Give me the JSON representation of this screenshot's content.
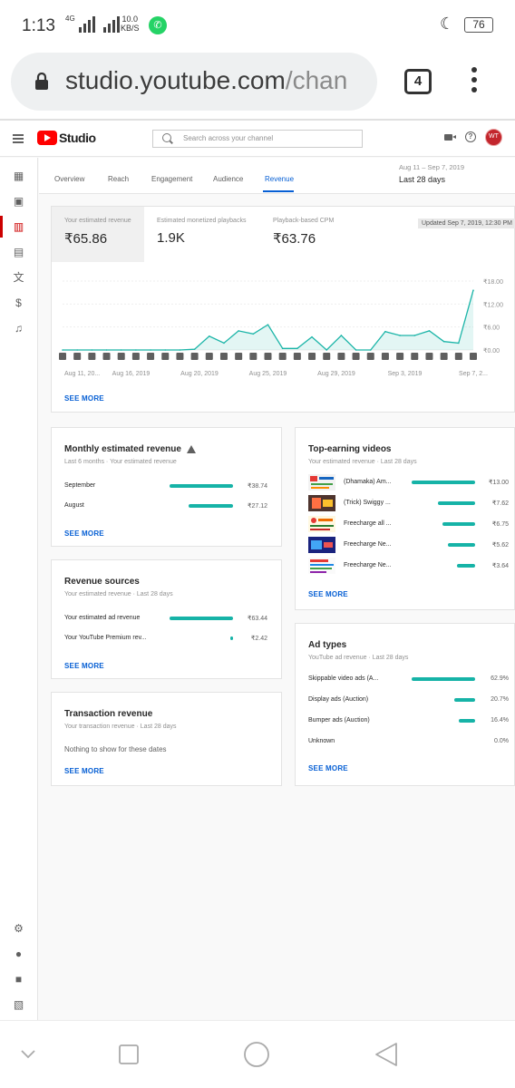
{
  "status_bar": {
    "time": "1:13",
    "network_label": "4G",
    "net_speed_value": "10.0",
    "net_speed_unit": "KB/S",
    "battery": "76"
  },
  "browser": {
    "url_host": "studio.youtube.com",
    "url_path_fragment": "/chan",
    "tab_count": "4"
  },
  "studio": {
    "app_name": "Studio",
    "search_placeholder": "Search across your channel",
    "avatar_initials": "WT",
    "tabs": [
      "Overview",
      "Reach",
      "Engagement",
      "Audience",
      "Revenue"
    ],
    "active_tab": "Revenue",
    "date_range": {
      "span": "Aug 11 – Sep 7, 2019",
      "label": "Last 28 days"
    }
  },
  "overview_card": {
    "metrics": [
      {
        "label": "Your estimated revenue",
        "value": "₹65.86"
      },
      {
        "label": "Estimated monetized playbacks",
        "value": "1.9K"
      },
      {
        "label": "Playback-based CPM",
        "value": "₹63.76"
      }
    ],
    "updated": "Updated Sep 7, 2019, 12:30 PM",
    "see_more": "SEE MORE"
  },
  "chart_data": {
    "type": "area",
    "x_labels": [
      "Aug 11, 20...",
      "Aug 16, 2019",
      "Aug 20, 2019",
      "Aug 25, 2019",
      "Aug 29, 2019",
      "Sep 3, 2019",
      "Sep 7, 2..."
    ],
    "y_ticks": [
      "₹18.00",
      "₹12.00",
      "₹6.00",
      "₹0.00"
    ],
    "ylim": [
      0,
      18
    ],
    "series": [
      {
        "values": [
          0,
          0,
          0,
          0,
          0,
          0,
          0,
          0,
          0,
          0.2,
          3.6,
          1.8,
          5.0,
          4.2,
          6.6,
          0.4,
          0.4,
          3.4,
          0,
          3.8,
          0,
          0,
          4.8,
          3.8,
          3.8,
          5.0,
          2.2,
          1.8,
          15.6
        ]
      }
    ],
    "color": "#1cb5a8"
  },
  "monthly": {
    "title": "Monthly estimated revenue",
    "subtitle": "Last 6 months · Your estimated revenue",
    "rows": [
      {
        "label": "September",
        "value": "₹38.74",
        "fraction": 1.0
      },
      {
        "label": "August",
        "value": "₹27.12",
        "fraction": 0.7
      }
    ],
    "see_more": "SEE MORE"
  },
  "sources": {
    "title": "Revenue sources",
    "subtitle": "Your estimated revenue · Last 28 days",
    "rows": [
      {
        "label": "Your estimated ad revenue",
        "value": "₹63.44",
        "fraction": 1.0
      },
      {
        "label": "Your YouTube Premium rev...",
        "value": "₹2.42",
        "fraction": 0.04
      }
    ],
    "see_more": "SEE MORE"
  },
  "transactions": {
    "title": "Transaction revenue",
    "subtitle": "Your transaction revenue · Last 28 days",
    "empty": "Nothing to show for these dates",
    "see_more": "SEE MORE"
  },
  "top_videos": {
    "title": "Top-earning videos",
    "subtitle": "Your estimated revenue · Last 28 days",
    "rows": [
      {
        "label": "(Dhamaka) Am...",
        "value": "₹13.00",
        "fraction": 1.0
      },
      {
        "label": "(Trick) Swiggy ...",
        "value": "₹7.62",
        "fraction": 0.59
      },
      {
        "label": "Freecharge all ...",
        "value": "₹6.75",
        "fraction": 0.52
      },
      {
        "label": "Freecharge Ne...",
        "value": "₹5.62",
        "fraction": 0.43
      },
      {
        "label": "Freecharge Ne...",
        "value": "₹3.64",
        "fraction": 0.28
      }
    ],
    "see_more": "SEE MORE"
  },
  "ad_types": {
    "title": "Ad types",
    "subtitle": "YouTube ad revenue · Last 28 days",
    "rows": [
      {
        "label": "Skippable video ads (A...",
        "value": "62.9%",
        "fraction": 1.0
      },
      {
        "label": "Display ads (Auction)",
        "value": "20.7%",
        "fraction": 0.33
      },
      {
        "label": "Bumper ads (Auction)",
        "value": "16.4%",
        "fraction": 0.26
      },
      {
        "label": "Unknown",
        "value": "0.0%",
        "fraction": 0
      }
    ],
    "see_more": "SEE MORE"
  },
  "colors": {
    "accent": "#065fd4",
    "bar": "#16b3a7",
    "brand": "#ff0000"
  }
}
